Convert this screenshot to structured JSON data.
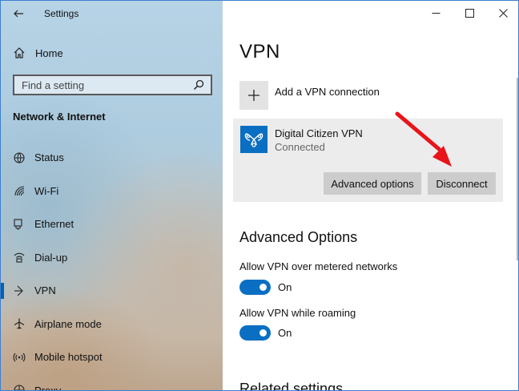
{
  "app_title": "Settings",
  "sidebar": {
    "home_label": "Home",
    "search_placeholder": "Find a setting",
    "section_title": "Network & Internet",
    "items": [
      {
        "label": "Status",
        "icon": "globe-icon"
      },
      {
        "label": "Wi-Fi",
        "icon": "wifi-icon"
      },
      {
        "label": "Ethernet",
        "icon": "ethernet-icon"
      },
      {
        "label": "Dial-up",
        "icon": "dialup-icon"
      },
      {
        "label": "VPN",
        "icon": "vpn-icon",
        "active": true
      },
      {
        "label": "Airplane mode",
        "icon": "airplane-icon"
      },
      {
        "label": "Mobile hotspot",
        "icon": "hotspot-icon"
      },
      {
        "label": "Proxy",
        "icon": "globe-icon"
      }
    ]
  },
  "main": {
    "title": "VPN",
    "add_vpn_label": "Add a VPN connection",
    "connection": {
      "name": "Digital Citizen VPN",
      "status": "Connected",
      "advanced_button": "Advanced options",
      "disconnect_button": "Disconnect"
    },
    "advanced_options_title": "Advanced Options",
    "options": [
      {
        "label": "Allow VPN over metered networks",
        "state": "On"
      },
      {
        "label": "Allow VPN while roaming",
        "state": "On"
      }
    ],
    "related_title": "Related settings"
  },
  "colors": {
    "accent": "#0a6fc2",
    "annotation_arrow": "#e8141a"
  }
}
